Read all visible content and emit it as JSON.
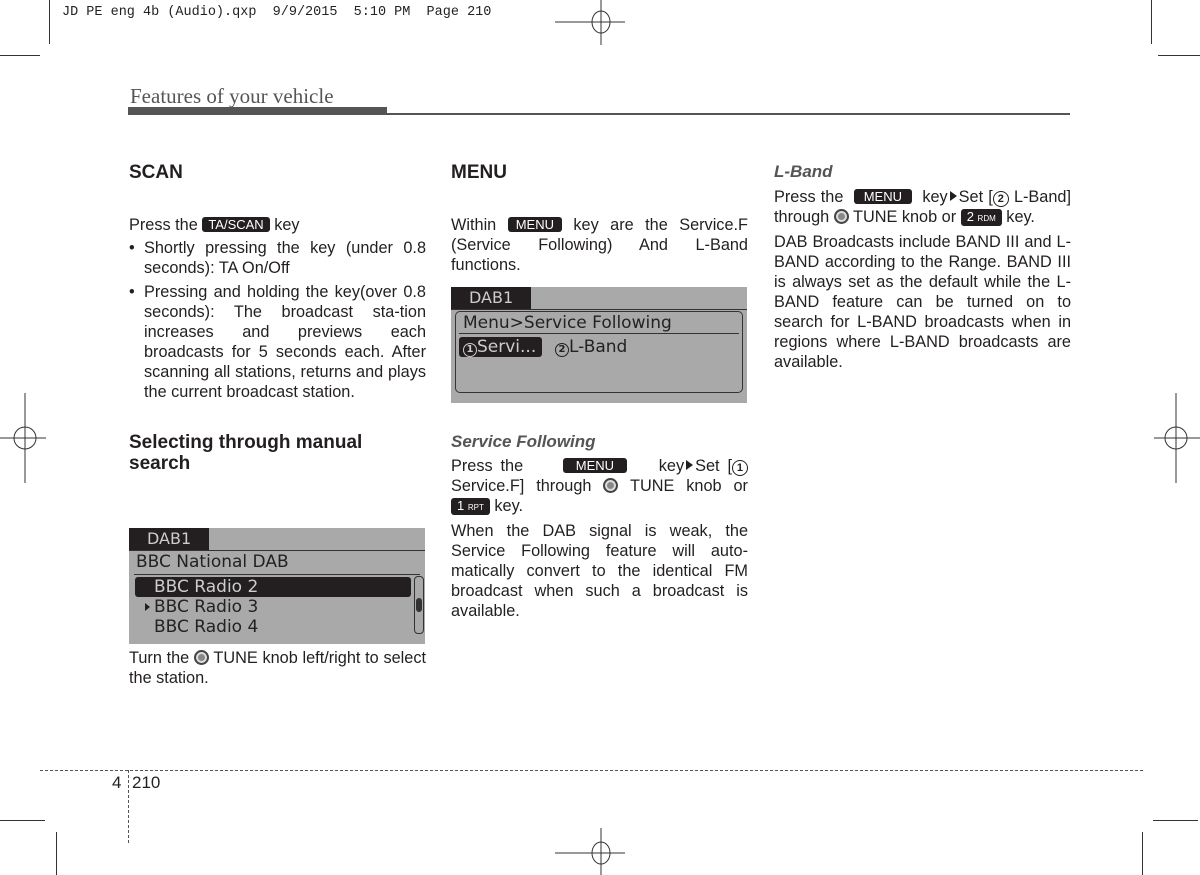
{
  "slug": "JD PE eng 4b (Audio).qxp  9/9/2015  5:10 PM  Page 210",
  "header": {
    "section_title": "Features of your vehicle"
  },
  "col1": {
    "scan_title": "SCAN",
    "scan_intro_pre": "Press the",
    "scan_key": "TA/SCAN",
    "scan_intro_post": "key",
    "bullets": [
      "Shortly pressing the key (under 0.8 seconds): TA On/Off",
      "Pressing and holding the key(over 0.8 seconds): The broadcast sta-tion increases and previews each broadcasts for 5 seconds each. After scanning all stations, returns and plays the current broadcast station."
    ],
    "manual_title": "Selecting through manual search",
    "screen": {
      "tab": "DAB1",
      "ensemble": "BBC National DAB",
      "items": [
        {
          "label": "BBC Radio 2",
          "selected": true,
          "playing": false
        },
        {
          "label": "BBC Radio 3",
          "selected": false,
          "playing": true
        },
        {
          "label": "BBC Radio 4",
          "selected": false,
          "playing": false
        }
      ]
    },
    "tune_pre": "Turn the",
    "tune_post": "TUNE knob left/right to select the station."
  },
  "col2": {
    "menu_title": "MENU",
    "menu_intro_pre": "Within",
    "menu_key": "MENU",
    "menu_intro_post": "key are the Service.F (Service Following) And L-Band functions.",
    "screen": {
      "tab": "DAB1",
      "path": "Menu>Service Following",
      "option1_num": "1",
      "option1": "Servi...",
      "option2_num": "2",
      "option2": "L-Band"
    },
    "sf_title": "Service Following",
    "sf_p1_a": "Press the",
    "sf_key": "MENU",
    "sf_p1_b": "key",
    "sf_p1_c": "Set [",
    "sf_num": "1",
    "sf_p1_d": "Service.F] through",
    "sf_p1_e": "TUNE knob or",
    "sf_key2_num": "1",
    "sf_key2_sub": "RPT",
    "sf_p1_f": "key.",
    "sf_p2": "When the DAB signal is weak, the Service Following feature will auto-matically convert to the identical FM broadcast when such a broadcast is available."
  },
  "col3": {
    "lb_title": "L-Band",
    "lb_p1_a": "Press the",
    "lb_key": "MENU",
    "lb_p1_b": "key",
    "lb_p1_c": "Set [",
    "lb_num": "2",
    "lb_p1_d": "L-Band] through",
    "lb_p1_e": "TUNE knob or",
    "lb_key2_num": "2",
    "lb_key2_sub": "RDM",
    "lb_p1_f": "key.",
    "lb_p2": "DAB Broadcasts include BAND III and L-BAND according to the Range. BAND III is always set as the default while the L-BAND feature can be turned on to search for L-BAND broadcasts when in regions where L-BAND broadcasts are available."
  },
  "footer": {
    "chapter": "4",
    "page": "210"
  }
}
